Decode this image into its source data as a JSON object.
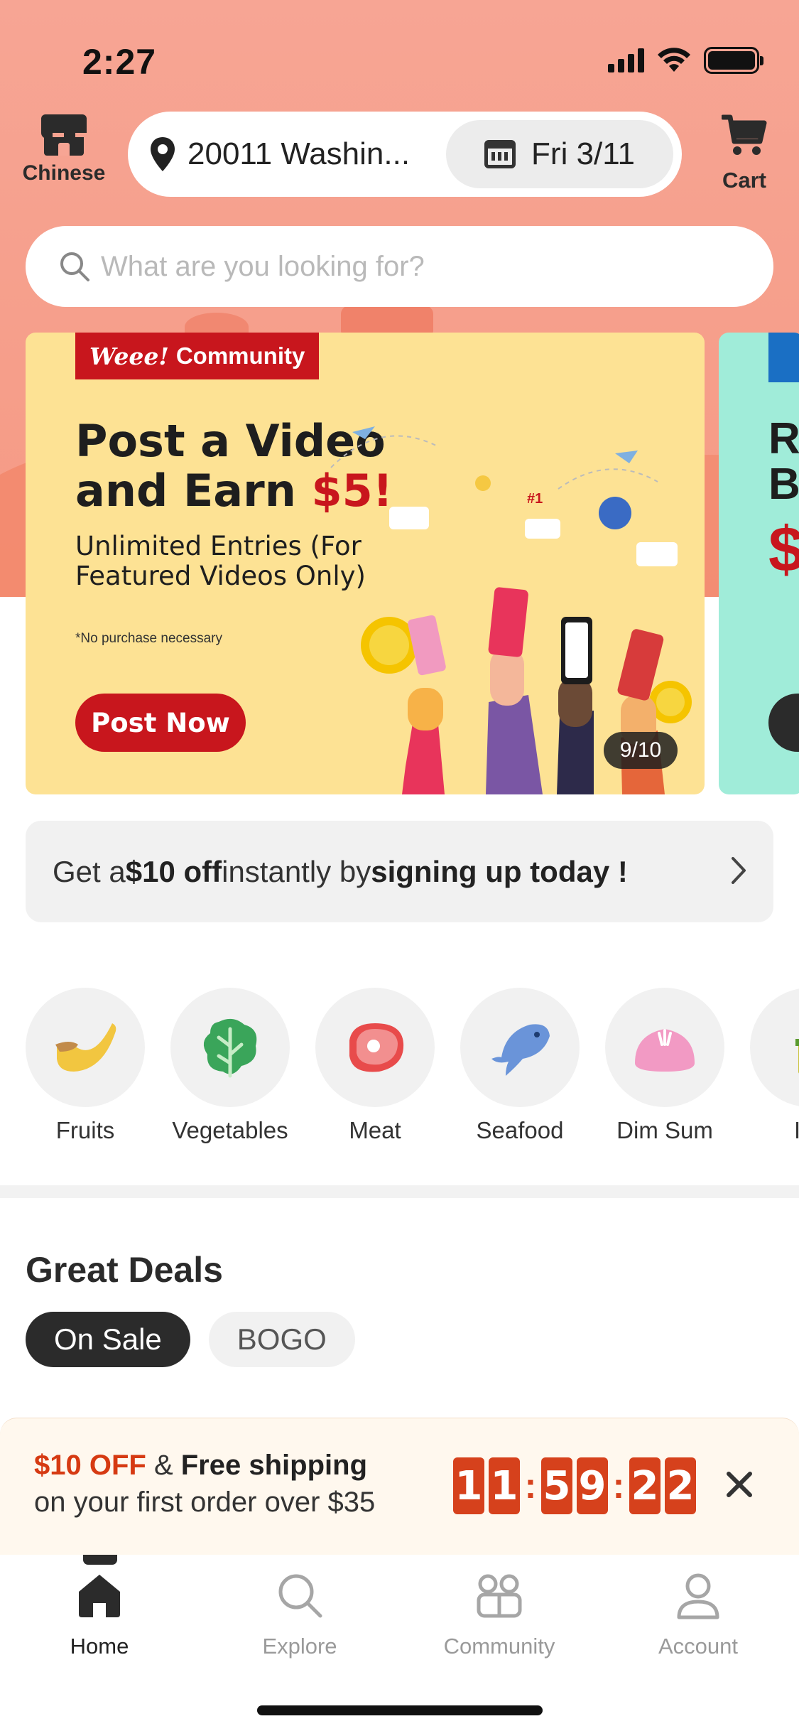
{
  "status_bar": {
    "time": "2:27"
  },
  "header": {
    "store_label": "Chinese",
    "address": "20011 Washin...",
    "date": "Fri 3/11",
    "cart_label": "Cart"
  },
  "search": {
    "placeholder": "What are you looking for?"
  },
  "banner": {
    "tag_brand": "Weee!",
    "tag_text": "Community",
    "title_line1": "Post a Video",
    "title_line2_prefix": "and Earn ",
    "title_line2_amount": "$5!",
    "subtitle": "Unlimited Entries (For Featured Videos Only)",
    "note": "*No purchase necessary",
    "button": "Post Now",
    "counter": "9/10",
    "next_title": "R B",
    "next_amount": "$"
  },
  "signup": {
    "pre": "Get a ",
    "amount": "$10 off",
    "mid": " instantly by ",
    "cta": "signing up today !"
  },
  "categories": [
    {
      "label": "Fruits",
      "icon": "banana-icon"
    },
    {
      "label": "Vegetables",
      "icon": "lettuce-icon"
    },
    {
      "label": "Meat",
      "icon": "steak-icon"
    },
    {
      "label": "Seafood",
      "icon": "fish-icon"
    },
    {
      "label": "Dim Sum",
      "icon": "bun-icon"
    },
    {
      "label": "Ins",
      "icon": "noodle-cup-icon"
    }
  ],
  "deals": {
    "title": "Great Deals",
    "chips": [
      "On Sale",
      "BOGO"
    ]
  },
  "promo": {
    "discount": "$10 OFF",
    "amp": " & ",
    "shipping": "Free shipping",
    "line2": "on your first order over $35",
    "timer": [
      "1",
      "1",
      "5",
      "9",
      "2",
      "2"
    ]
  },
  "tabs": [
    {
      "label": "Home",
      "icon": "home-icon",
      "active": true
    },
    {
      "label": "Explore",
      "icon": "search-icon",
      "active": false
    },
    {
      "label": "Community",
      "icon": "community-icon",
      "active": false
    },
    {
      "label": "Account",
      "icon": "person-icon",
      "active": false
    }
  ],
  "colors": {
    "brand_red": "#c8161d",
    "hero_salmon": "#f7a594",
    "banner_yellow": "#fde294",
    "timer_orange": "#d6411c"
  }
}
